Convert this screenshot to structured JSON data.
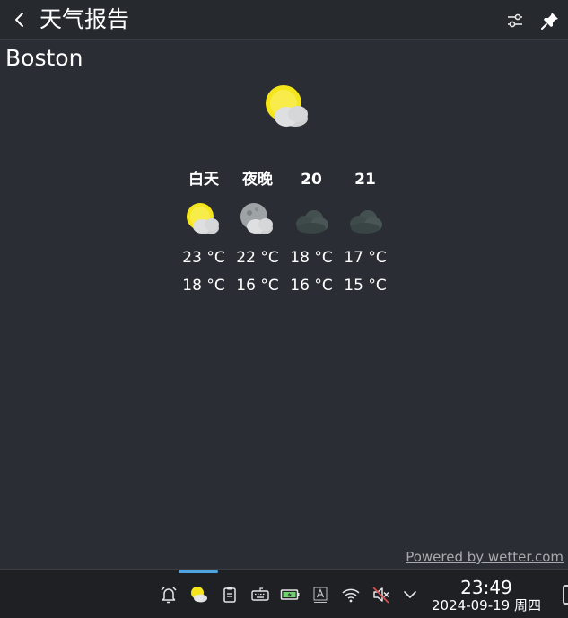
{
  "header": {
    "title": "天气报告",
    "back_icon": "chevron-left-icon",
    "settings_icon": "sliders-icon",
    "pin_icon": "pin-icon"
  },
  "city": "Boston",
  "current": {
    "icon": "partly-sunny-icon"
  },
  "forecast": [
    {
      "label": "白天",
      "icon": "partly-sunny-icon",
      "high": "23 °C",
      "low": "18 °C"
    },
    {
      "label": "夜晚",
      "icon": "partly-cloudy-night-icon",
      "high": "22 °C",
      "low": "16 °C"
    },
    {
      "label": "20",
      "icon": "cloudy-icon",
      "high": "18 °C",
      "low": "16 °C"
    },
    {
      "label": "21",
      "icon": "cloudy-icon",
      "high": "17 °C",
      "low": "15 °C"
    }
  ],
  "footer": {
    "powered_by": "Powered by wetter.com"
  },
  "taskbar": {
    "tray_icons": [
      "alarm-icon",
      "weather-icon",
      "clipboard-icon",
      "keyboard-icon",
      "battery-icon",
      "input-method-icon",
      "wifi-icon",
      "volume-muted-icon",
      "chevron-down-icon"
    ],
    "time": "23:49",
    "date": "2024-09-19 周四"
  },
  "colors": {
    "panel_bg": "#2a2d33",
    "header_bg": "#26292e",
    "taskbar_bg": "#1e2024",
    "accent": "#4fa3e0",
    "sun": "#f5e51b",
    "cloud": "#d8d8d8",
    "dark_cloud": "#3f4a4a"
  }
}
